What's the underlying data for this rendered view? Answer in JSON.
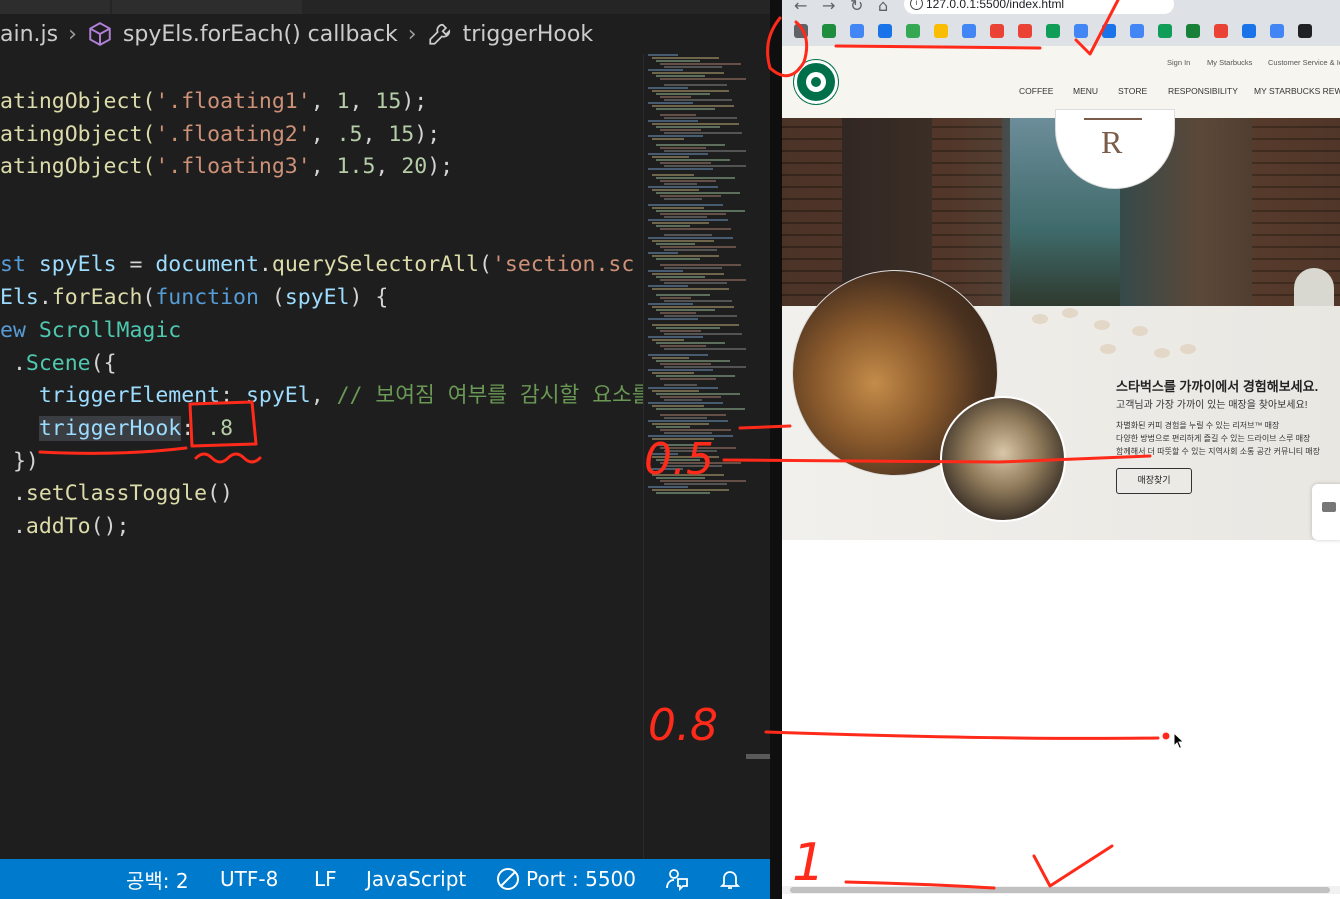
{
  "editor": {
    "breadcrumb": {
      "file": "ain.js",
      "callback": "spyEls.forEach() callback",
      "property": "triggerHook"
    },
    "code_lines": [
      [
        {
          "t": "atingObject(",
          "c": "fn"
        },
        {
          "t": "'.floating1'",
          "c": "str"
        },
        {
          "t": ", ",
          "c": ""
        },
        {
          "t": "1",
          "c": "num"
        },
        {
          "t": ", ",
          "c": ""
        },
        {
          "t": "15",
          "c": "num"
        },
        {
          "t": ");",
          "c": ""
        }
      ],
      [
        {
          "t": "atingObject(",
          "c": "fn"
        },
        {
          "t": "'.floating2'",
          "c": "str"
        },
        {
          "t": ", ",
          "c": ""
        },
        {
          "t": ".5",
          "c": "num"
        },
        {
          "t": ", ",
          "c": ""
        },
        {
          "t": "15",
          "c": "num"
        },
        {
          "t": ");",
          "c": ""
        }
      ],
      [
        {
          "t": "atingObject(",
          "c": "fn"
        },
        {
          "t": "'.floating3'",
          "c": "str"
        },
        {
          "t": ", ",
          "c": ""
        },
        {
          "t": "1.5",
          "c": "num"
        },
        {
          "t": ", ",
          "c": ""
        },
        {
          "t": "20",
          "c": "num"
        },
        {
          "t": ");",
          "c": ""
        }
      ],
      [],
      [],
      [
        {
          "t": "st ",
          "c": "kw"
        },
        {
          "t": "spyEls",
          "c": "var"
        },
        {
          "t": " = ",
          "c": ""
        },
        {
          "t": "document",
          "c": "var"
        },
        {
          "t": ".",
          "c": ""
        },
        {
          "t": "querySelectorAll",
          "c": "fn"
        },
        {
          "t": "(",
          "c": ""
        },
        {
          "t": "'section.sc",
          "c": "str"
        }
      ],
      [
        {
          "t": "Els",
          "c": "var"
        },
        {
          "t": ".",
          "c": ""
        },
        {
          "t": "forEach",
          "c": "fn"
        },
        {
          "t": "(",
          "c": ""
        },
        {
          "t": "function",
          "c": "kw"
        },
        {
          "t": " (",
          "c": ""
        },
        {
          "t": "spyEl",
          "c": "var"
        },
        {
          "t": ") {",
          "c": ""
        }
      ],
      [
        {
          "t": "ew ",
          "c": "kw"
        },
        {
          "t": "ScrollMagic",
          "c": "cls"
        }
      ],
      [
        {
          "t": " .",
          "c": ""
        },
        {
          "t": "Scene",
          "c": "cls"
        },
        {
          "t": "({",
          "c": ""
        }
      ],
      [
        {
          "t": "   triggerElement",
          "c": "prop"
        },
        {
          "t": ": ",
          "c": ""
        },
        {
          "t": "spyEl",
          "c": "var"
        },
        {
          "t": ", ",
          "c": ""
        },
        {
          "t": "// 보여짐 여부를 감시할 요소를",
          "c": "cmt"
        }
      ],
      [
        {
          "t": "   ",
          "c": ""
        },
        {
          "t": "triggerHook",
          "c": "prop",
          "hl": true
        },
        {
          "t": ": ",
          "c": ""
        },
        {
          "t": ".8",
          "c": "num"
        }
      ],
      [
        {
          "t": " })",
          "c": ""
        }
      ],
      [
        {
          "t": " .",
          "c": ""
        },
        {
          "t": "setClassToggle",
          "c": "fn"
        },
        {
          "t": "()",
          "c": ""
        }
      ],
      [
        {
          "t": " .",
          "c": ""
        },
        {
          "t": "addTo",
          "c": "fn"
        },
        {
          "t": "();",
          "c": ""
        }
      ]
    ]
  },
  "statusbar": {
    "indent": "공백: 2",
    "encoding": "UTF-8",
    "eol": "LF",
    "language": "JavaScript",
    "port": "Port : 5500"
  },
  "browser": {
    "url": "127.0.0.1:5500/index.html",
    "util_links": [
      "Sign In",
      "My Starbucks",
      "Customer Service & Ide"
    ],
    "nav": [
      "COFFEE",
      "MENU",
      "STORE",
      "RESPONSIBILITY",
      "MY STARBUCKS REWA"
    ],
    "reserve_letter": "R",
    "store": {
      "title": "스타벅스를 가까이에서 경험해보세요.",
      "subtitle": "고객님과 가장 가까이 있는 매장을 찾아보세요!",
      "desc1": "차별화된 커피 경험을 누릴 수 있는 리저브™ 매장",
      "desc2": "다양한 방법으로 편리하게 즐길 수 있는 드라이브 스루 매장",
      "desc3": "함께해서 더 따뜻할 수 있는 지역사회 소통 공간 커뮤니티 매장",
      "button": "매장찾기"
    }
  },
  "annotations": {
    "label_half": "0.5",
    "label_eight": "0.8",
    "label_one": "1"
  },
  "colors": {
    "editor_bg": "#1e1e1e",
    "statusbar": "#007acc",
    "annotation": "#ff2a1a",
    "starbucks_green": "#00704a"
  }
}
